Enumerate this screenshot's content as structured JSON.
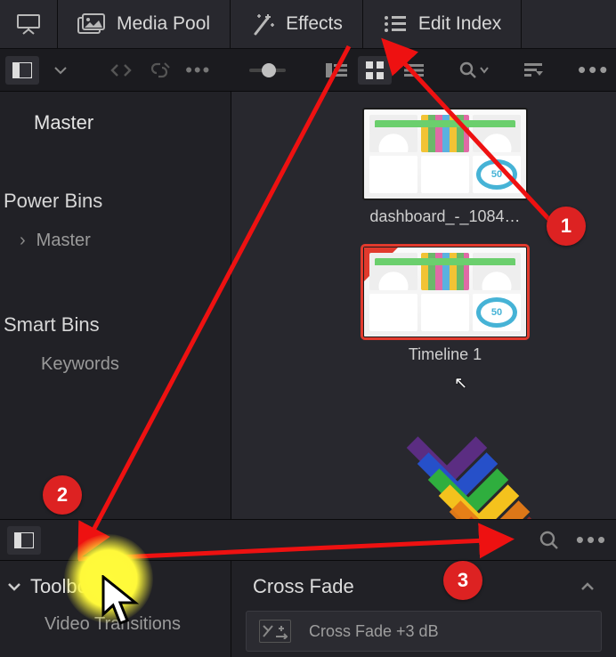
{
  "topbar": {
    "media_pool": "Media Pool",
    "effects": "Effects",
    "edit_index": "Edit Index"
  },
  "sidebar": {
    "master": "Master",
    "power_bins": "Power Bins",
    "pb_master": "Master",
    "smart_bins": "Smart Bins",
    "sb_keywords": "Keywords"
  },
  "clips": {
    "c1_label": "dashboard_-_1084…",
    "c2_label": "Timeline 1",
    "c2_ring": "50"
  },
  "bottom": {
    "toolbox_label": "Toolbox",
    "video_trans": "Video Transitions",
    "crossfade_hdr": "Cross Fade",
    "crossfade_item": "Cross Fade +3 dB"
  },
  "annotations": {
    "b1": "1",
    "b2": "2",
    "b3": "3"
  }
}
